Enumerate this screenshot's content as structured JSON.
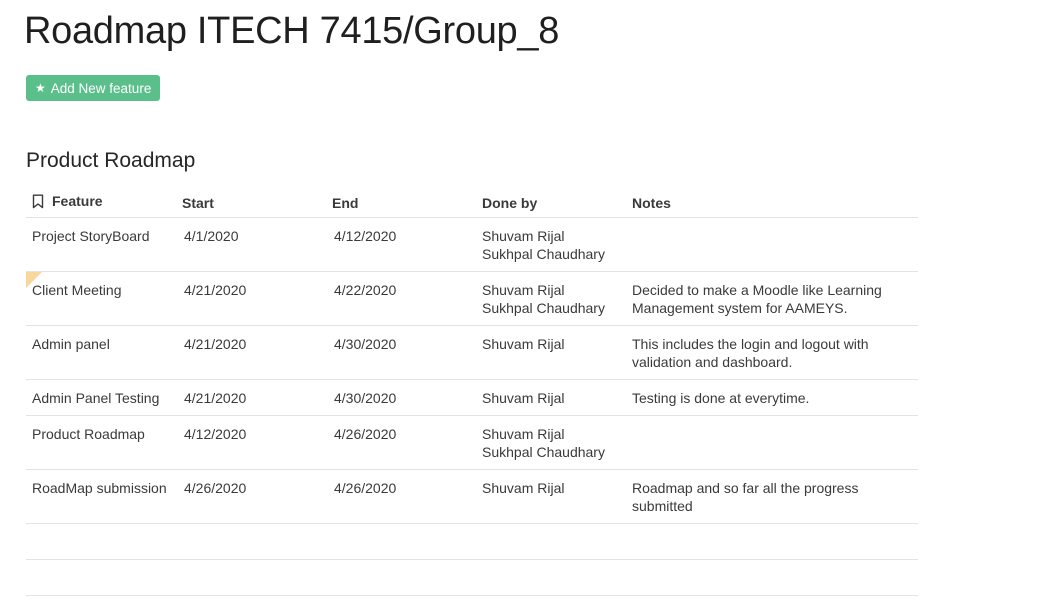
{
  "page": {
    "title": "Roadmap ITECH 7415/Group_8"
  },
  "toolbar": {
    "add_label": "Add New feature",
    "add_icon": "star-icon"
  },
  "section": {
    "title": "Product Roadmap"
  },
  "table": {
    "headers": {
      "feature": "Feature",
      "start": "Start",
      "end": "End",
      "done_by": "Done by",
      "notes": "Notes"
    },
    "rows": [
      {
        "feature": "Project StoryBoard",
        "start": "4/1/2020",
        "end": "4/12/2020",
        "done_by": [
          "Shuvam Rijal",
          "Sukhpal Chaudhary"
        ],
        "notes": ""
      },
      {
        "feature": "Client Meeting",
        "start": "4/21/2020",
        "end": "4/22/2020",
        "done_by": [
          "Shuvam Rijal",
          "Sukhpal Chaudhary"
        ],
        "notes": "Decided to make a Moodle like Learning Management system for AAMEYS."
      },
      {
        "feature": "Admin panel",
        "start": "4/21/2020",
        "end": "4/30/2020",
        "done_by": [
          "Shuvam Rijal"
        ],
        "notes": "This includes the login and logout with validation and dashboard."
      },
      {
        "feature": "Admin Panel Testing",
        "start": "4/21/2020",
        "end": "4/30/2020",
        "done_by": [
          "Shuvam Rijal"
        ],
        "notes": "Testing is done at everytime."
      },
      {
        "feature": "Product Roadmap",
        "start": "4/12/2020",
        "end": "4/26/2020",
        "done_by": [
          "Shuvam Rijal",
          "Sukhpal Chaudhary"
        ],
        "notes": ""
      },
      {
        "feature": "RoadMap submission",
        "start": "4/26/2020",
        "end": "4/26/2020",
        "done_by": [
          "Shuvam Rijal"
        ],
        "notes": "Roadmap and so far all the progress submitted"
      }
    ]
  },
  "colors": {
    "accent": "#5bbf8c",
    "flag": "#f7d89a",
    "border": "#e3e3e3"
  }
}
